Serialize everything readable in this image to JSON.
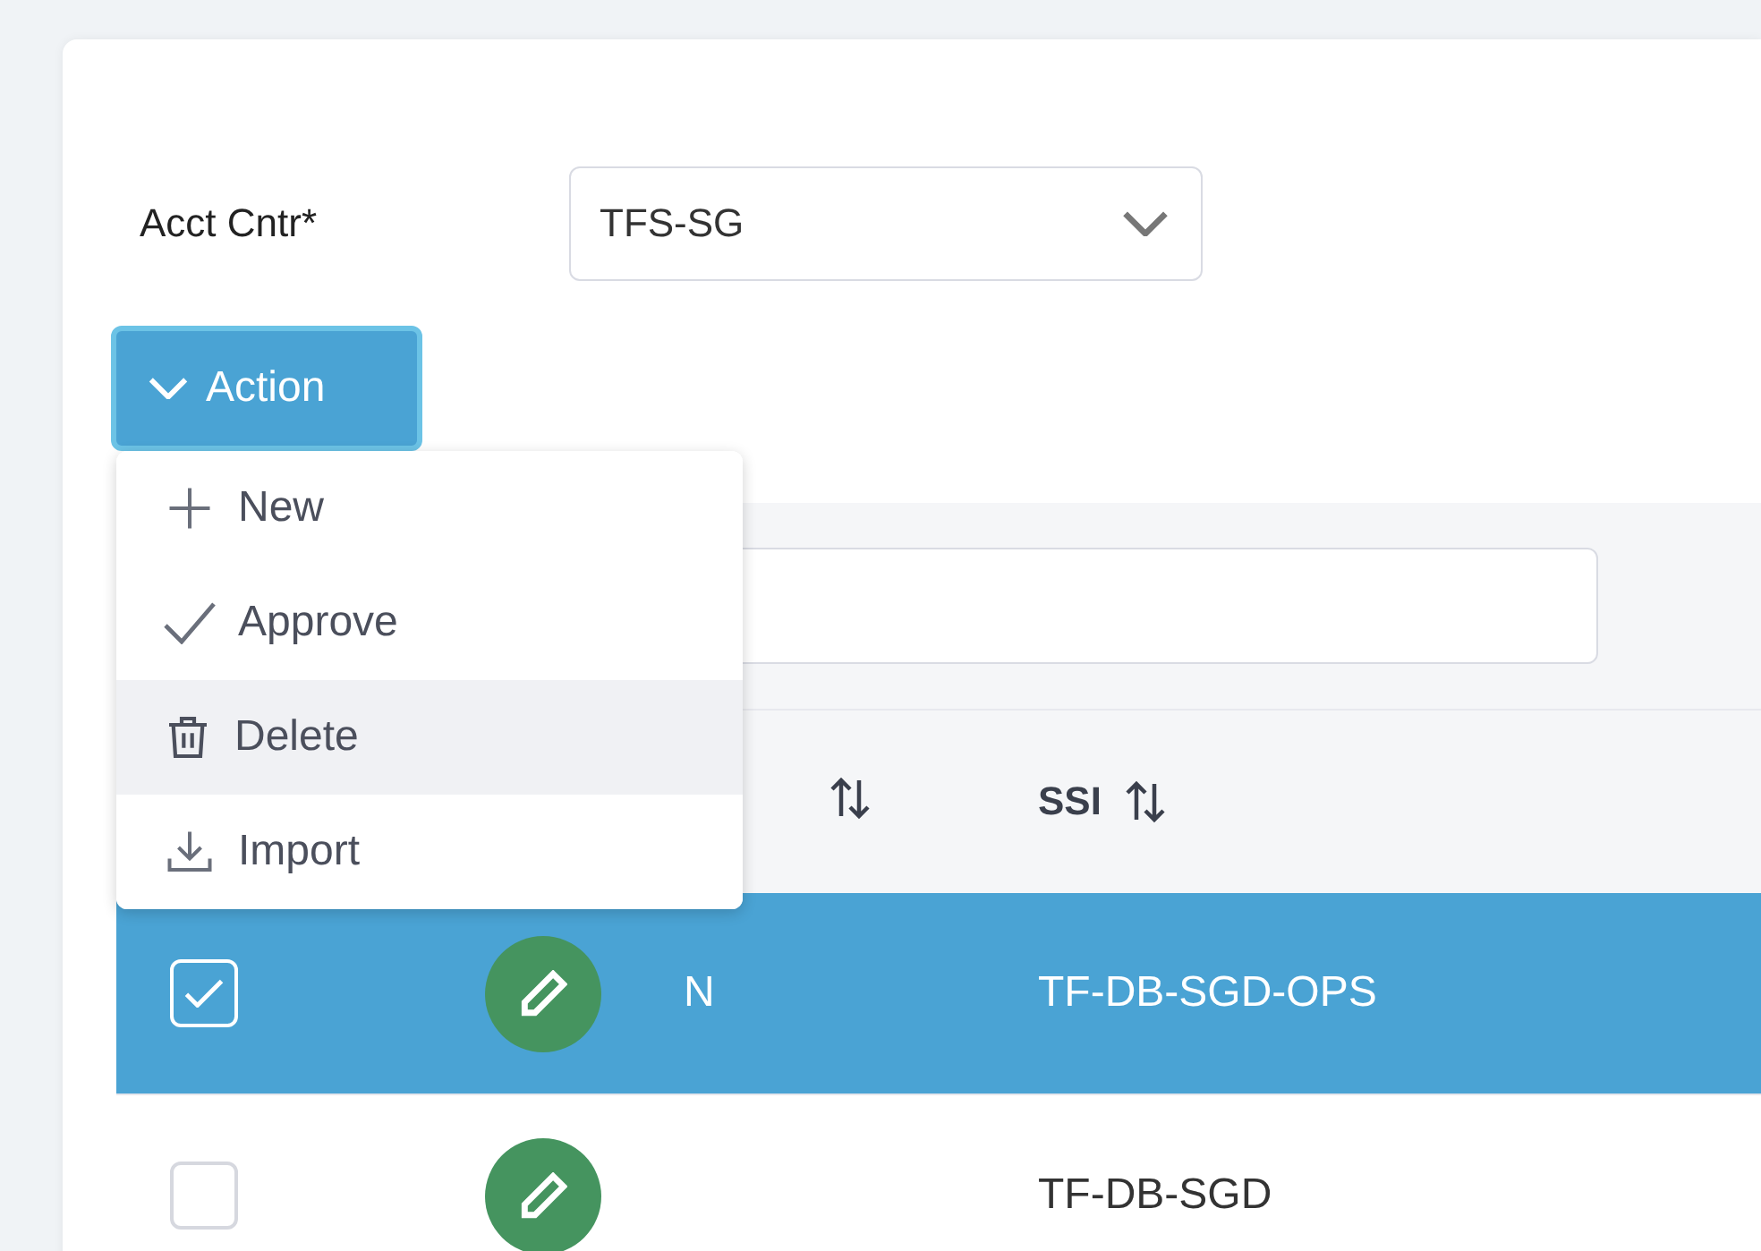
{
  "filter": {
    "label": "Acct Cntr*",
    "value": "TFS-SG"
  },
  "action_button": {
    "label": "Action",
    "expanded": true
  },
  "action_menu": [
    {
      "kind": "new",
      "label": "New",
      "highlighted": false
    },
    {
      "kind": "approve",
      "label": "Approve",
      "highlighted": false
    },
    {
      "kind": "delete",
      "label": "Delete",
      "highlighted": true
    },
    {
      "kind": "import",
      "label": "Import",
      "highlighted": false
    }
  ],
  "table": {
    "columns": [
      {
        "label": "SSI"
      }
    ],
    "rows": [
      {
        "selected": true,
        "flag": "N",
        "ssi": "TF-DB-SGD-OPS"
      },
      {
        "selected": false,
        "ssi": "TF-DB-SGD"
      }
    ]
  }
}
